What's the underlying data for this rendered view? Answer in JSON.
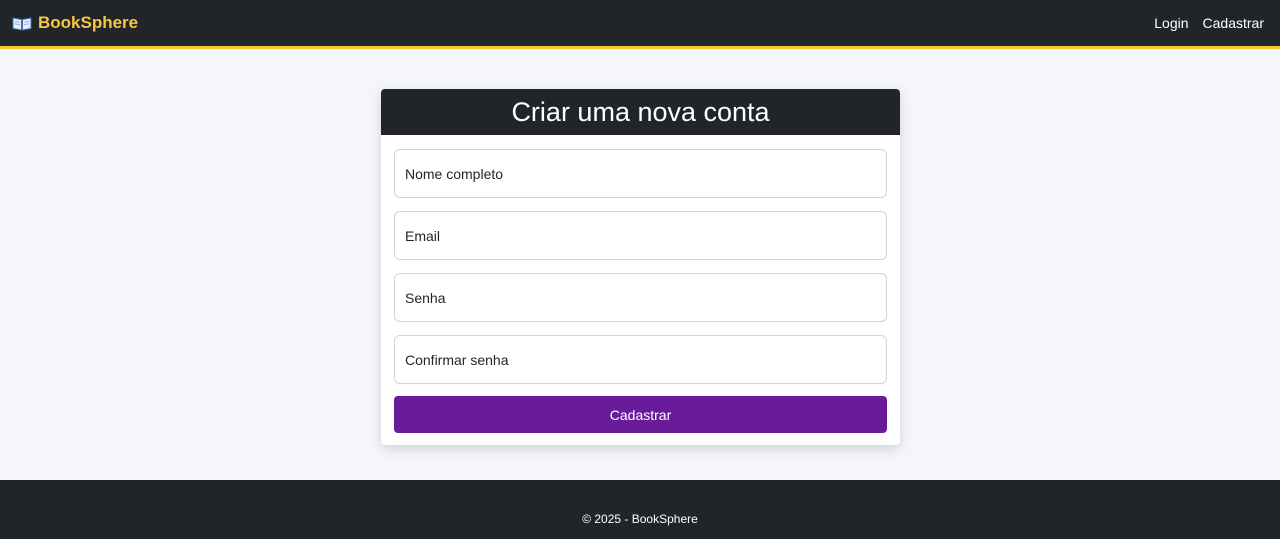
{
  "navbar": {
    "brand_icon": "open-book-icon",
    "brand": "BookSphere",
    "links": [
      "Login",
      "Cadastrar"
    ]
  },
  "form": {
    "title": "Criar uma nova conta",
    "fields": [
      {
        "placeholder": "Nome completo",
        "value": ""
      },
      {
        "placeholder": "Email",
        "value": ""
      },
      {
        "placeholder": "Senha",
        "value": ""
      },
      {
        "placeholder": "Confirmar senha",
        "value": ""
      }
    ],
    "submit_label": "Cadastrar"
  },
  "footer": {
    "text": "© 2025 - BookSphere"
  },
  "colors": {
    "navbar_bg": "#212529",
    "brand": "#f6c744",
    "accent_border": "#f3c53d",
    "button": "#6a1b9a",
    "page_bg": "#f4f6fb"
  }
}
